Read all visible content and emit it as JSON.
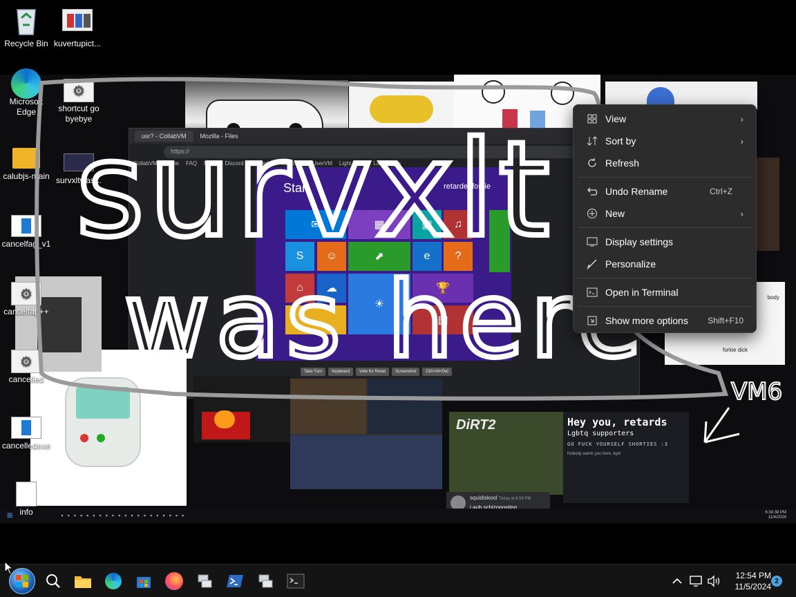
{
  "desktop": {
    "top_icons": [
      {
        "label": "Recycle Bin",
        "icon": "recycle-bin-icon"
      },
      {
        "label": "kuvertupict...",
        "icon": "image-file-icon"
      }
    ],
    "column_icons": [
      {
        "label": "Microsoft Edge",
        "icon": "edge-icon"
      },
      {
        "label": "shortcut go byebye",
        "icon": "settings-shortcut-icon"
      },
      {
        "label": "calubjs-main",
        "icon": "folder-icon"
      },
      {
        "label": "survxltwas...",
        "icon": "image-file-icon"
      },
      {
        "label": "cancelfag_v1",
        "icon": "document-icon"
      },
      {
        "label": "cancelfag++",
        "icon": "settings-shortcut-icon"
      },
      {
        "label": "cancelled",
        "icon": "settings-shortcut-icon"
      },
      {
        "label": "cancelledexe",
        "icon": "document-icon"
      },
      {
        "label": "info",
        "icon": "text-file-icon"
      }
    ]
  },
  "wallpaper": {
    "browser_tabs": [
      "usr? - CollabVM",
      "Mozilla - Files"
    ],
    "browser_nav": [
      "CollabVM",
      "Home",
      "FAQ",
      "Rules",
      "Discord",
      "Subreddit",
      "Mastodon",
      "UserVM",
      "Light Mode",
      "Languages"
    ],
    "vm_start_label": "Start",
    "vm_user_label": "retardedforkie",
    "vm_buttons": [
      "Take Turn",
      "Keyboard",
      "Vote for Reset",
      "Screenshot",
      "Ctrl+Alt+Del"
    ],
    "poster": {
      "line1": "Hey you, retards",
      "line2": "Lgbtq supporters",
      "line3": "GO FUCK YOURSELF SHORTIES :3",
      "line4": "Nobody wants you here, bye!"
    },
    "chat": {
      "user": "squidiskool",
      "time": "Today at 6:58 PM",
      "message": "i aub schizoposting"
    },
    "forkie_caption": "forkie dick",
    "body_caption": "body"
  },
  "graffiti": {
    "line1": "survxlt",
    "line2": "was here",
    "tag": "VM6"
  },
  "context_menu": {
    "items": [
      {
        "label": "View",
        "icon": "view-grid-icon",
        "submenu": true
      },
      {
        "label": "Sort by",
        "icon": "sort-icon",
        "submenu": true
      },
      {
        "label": "Refresh",
        "icon": "refresh-icon"
      },
      {
        "label": "Undo Rename",
        "icon": "undo-icon",
        "shortcut": "Ctrl+Z"
      },
      {
        "label": "New",
        "icon": "new-plus-icon",
        "submenu": true
      },
      {
        "label": "Display settings",
        "icon": "display-icon"
      },
      {
        "label": "Personalize",
        "icon": "brush-icon"
      },
      {
        "label": "Open in Terminal",
        "icon": "terminal-icon"
      },
      {
        "label": "Show more options",
        "icon": "more-options-icon",
        "shortcut": "Shift+F10"
      }
    ]
  },
  "taskbar": {
    "apps": [
      "start-orb-icon",
      "search-icon",
      "file-explorer-icon",
      "edge-icon",
      "store-icon",
      "firefox-icon",
      "vm-box-icon",
      "powershell-icon",
      "vm-box-icon",
      "terminal-icon"
    ],
    "time": "12:54 PM",
    "date": "11/5/2024",
    "notifications": "2",
    "inner_time": "6:34:38 PM",
    "inner_date": "11/4/2024"
  }
}
